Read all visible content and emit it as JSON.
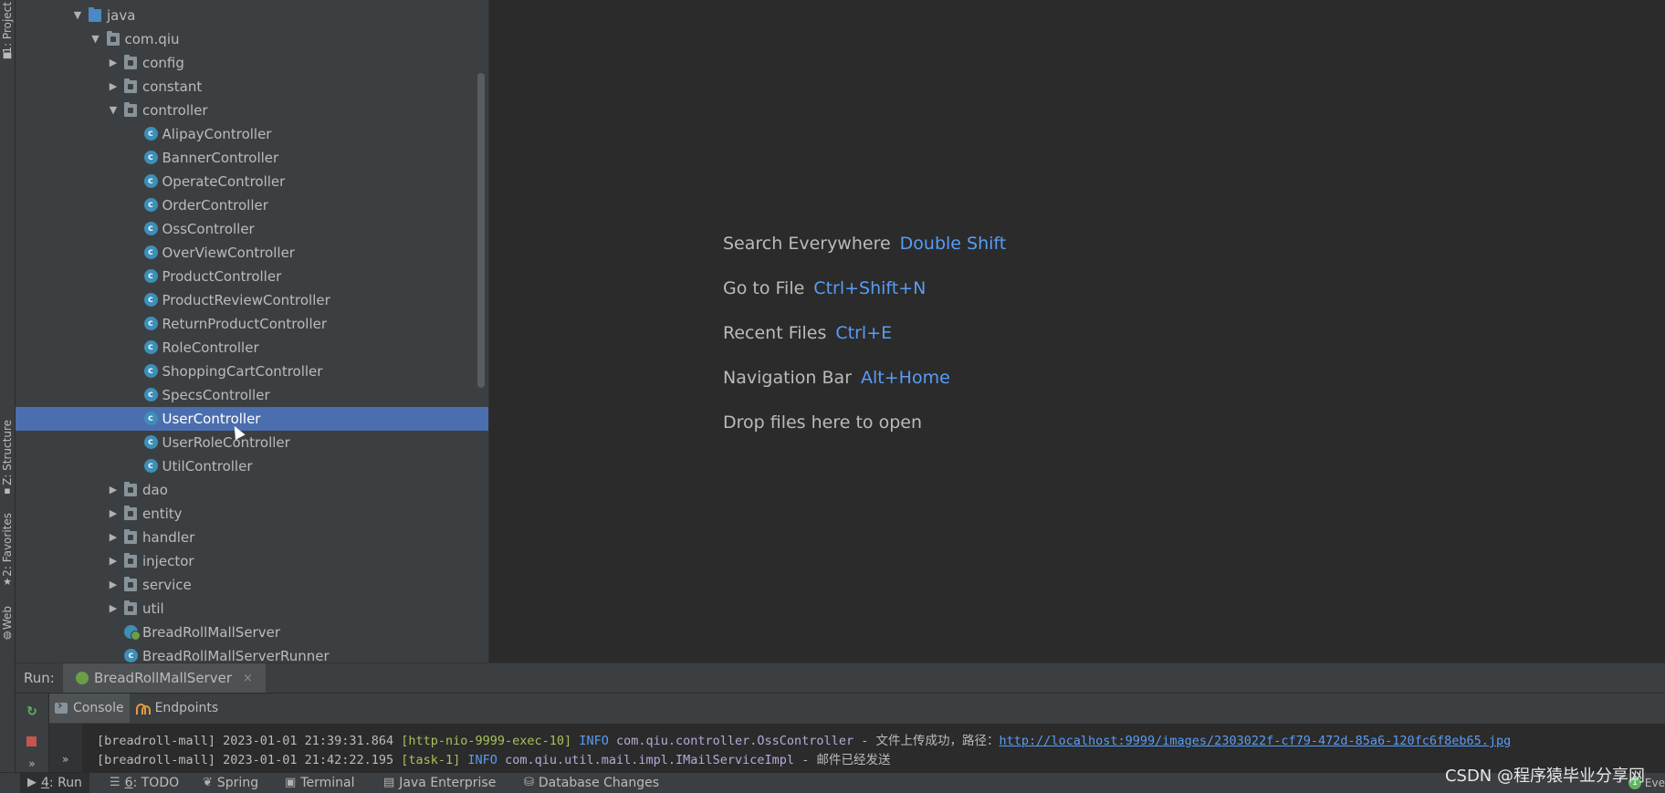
{
  "left_strip": {
    "project_tab": "1: Project",
    "structure_tab": "Z: Structure",
    "favorites_tab": "2: Favorites",
    "web_tab": "Web"
  },
  "project_tree": [
    {
      "label": "java",
      "type": "source-folder",
      "expanded": true
    },
    {
      "label": "com.qiu",
      "type": "package",
      "expanded": true
    },
    {
      "label": "config",
      "type": "package",
      "expanded": false
    },
    {
      "label": "constant",
      "type": "package",
      "expanded": false
    },
    {
      "label": "controller",
      "type": "package",
      "expanded": true
    },
    {
      "label": "AlipayController",
      "type": "class"
    },
    {
      "label": "BannerController",
      "type": "class"
    },
    {
      "label": "OperateController",
      "type": "class"
    },
    {
      "label": "OrderController",
      "type": "class"
    },
    {
      "label": "OssController",
      "type": "class"
    },
    {
      "label": "OverViewController",
      "type": "class"
    },
    {
      "label": "ProductController",
      "type": "class"
    },
    {
      "label": "ProductReviewController",
      "type": "class"
    },
    {
      "label": "ReturnProductController",
      "type": "class"
    },
    {
      "label": "RoleController",
      "type": "class"
    },
    {
      "label": "ShoppingCartController",
      "type": "class"
    },
    {
      "label": "SpecsController",
      "type": "class"
    },
    {
      "label": "UserController",
      "type": "class",
      "selected": true
    },
    {
      "label": "UserRoleController",
      "type": "class"
    },
    {
      "label": "UtilController",
      "type": "class"
    },
    {
      "label": "dao",
      "type": "package",
      "expanded": false
    },
    {
      "label": "entity",
      "type": "package",
      "expanded": false
    },
    {
      "label": "handler",
      "type": "package",
      "expanded": false
    },
    {
      "label": "injector",
      "type": "package",
      "expanded": false
    },
    {
      "label": "service",
      "type": "package",
      "expanded": false
    },
    {
      "label": "util",
      "type": "package",
      "expanded": false
    },
    {
      "label": "BreadRollMallServer",
      "type": "spring-class"
    },
    {
      "label": "BreadRollMallServerRunner",
      "type": "class"
    }
  ],
  "editor_hints": [
    {
      "action": "Search Everywhere",
      "shortcut": "Double Shift"
    },
    {
      "action": "Go to File",
      "shortcut": "Ctrl+Shift+N"
    },
    {
      "action": "Recent Files",
      "shortcut": "Ctrl+E"
    },
    {
      "action": "Navigation Bar",
      "shortcut": "Alt+Home"
    },
    {
      "action": "Drop files here to open",
      "shortcut": ""
    }
  ],
  "run_panel": {
    "title": "Run:",
    "config_tab": "BreadRollMallServer",
    "close_glyph": "×",
    "tabs": {
      "console": "Console",
      "endpoints": "Endpoints"
    }
  },
  "console_log": [
    {
      "prefix": "[breadroll-mall] 2023-01-01 21:39:31.864",
      "thread": "[http-nio-9999-exec-10]",
      "level": "INFO",
      "logger": "com.qiu.controller.OssController",
      "message": "- 文件上传成功，路径：",
      "link": "http://localhost:9999/images/2303022f-cf79-472d-85a6-120fc6f8eb65.jpg"
    },
    {
      "prefix": "[breadroll-mall] 2023-01-01 21:42:22.195",
      "thread": "[task-1]",
      "level": "INFO",
      "logger": "com.qiu.util.mail.impl.IMailServiceImpl",
      "message": "- 邮件已经发送",
      "link": ""
    }
  ],
  "bottom_bar": {
    "run_num": "4",
    "run_label": ": Run",
    "todo_num": "6",
    "todo_label": ": TODO",
    "spring": "Spring",
    "terminal": "Terminal",
    "java_enterprise": "Java Enterprise",
    "database_changes": "Database Changes",
    "event_badge": "1",
    "event_log": "Eve"
  },
  "watermark": "CSDN @程序猿毕业分享网",
  "colors": {
    "selection": "#4b6eaf",
    "shortcut_blue": "#589df6",
    "panel_bg": "#3c3f41",
    "editor_bg": "#2b2b2b"
  }
}
